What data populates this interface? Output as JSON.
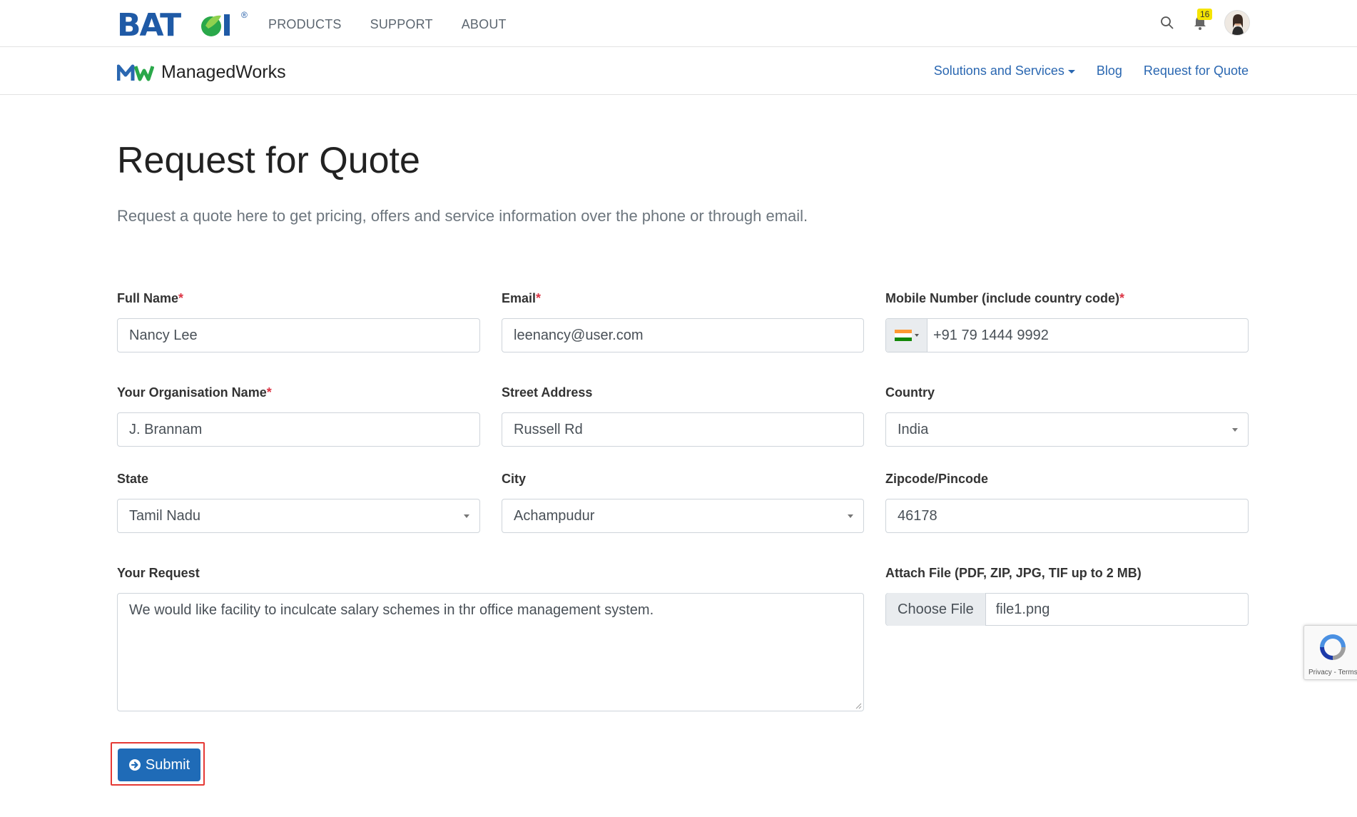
{
  "topbar": {
    "logo_text": "BATOI",
    "nav": [
      "PRODUCTS",
      "SUPPORT",
      "ABOUT"
    ],
    "notification_count": "16"
  },
  "subbar": {
    "brand_name": "ManagedWorks",
    "nav": {
      "solutions": "Solutions and Services",
      "blog": "Blog",
      "rfq": "Request for Quote"
    }
  },
  "page": {
    "title": "Request for Quote",
    "lead": "Request a quote here to get pricing, offers and service information over the phone or through email."
  },
  "form": {
    "full_name": {
      "label": "Full Name",
      "value": "Nancy Lee"
    },
    "email": {
      "label": "Email",
      "value": "leenancy@user.com"
    },
    "mobile": {
      "label": "Mobile Number (include country code)",
      "value": "+91 79 1444 9992"
    },
    "organisation": {
      "label": "Your Organisation Name",
      "value": "J. Brannam"
    },
    "street": {
      "label": "Street Address",
      "value": "Russell Rd"
    },
    "country": {
      "label": "Country",
      "value": "India"
    },
    "state": {
      "label": "State",
      "value": "Tamil Nadu"
    },
    "city": {
      "label": "City",
      "value": "Achampudur"
    },
    "zipcode": {
      "label": "Zipcode/Pincode",
      "value": "46178"
    },
    "request": {
      "label": "Your Request",
      "value": "We would like facility to inculcate salary schemes in thr office management system."
    },
    "attach": {
      "label": "Attach File (PDF, ZIP, JPG, TIF up to 2 MB)",
      "button": "Choose File",
      "filename": "file1.png"
    },
    "required_mark": "*",
    "submit_label": "Submit"
  },
  "recaptcha": {
    "links": "Privacy - Terms"
  },
  "colors": {
    "accent": "#1f6bb7",
    "link": "#2a67b1",
    "required": "#dc3545",
    "highlight": "#e53935"
  }
}
